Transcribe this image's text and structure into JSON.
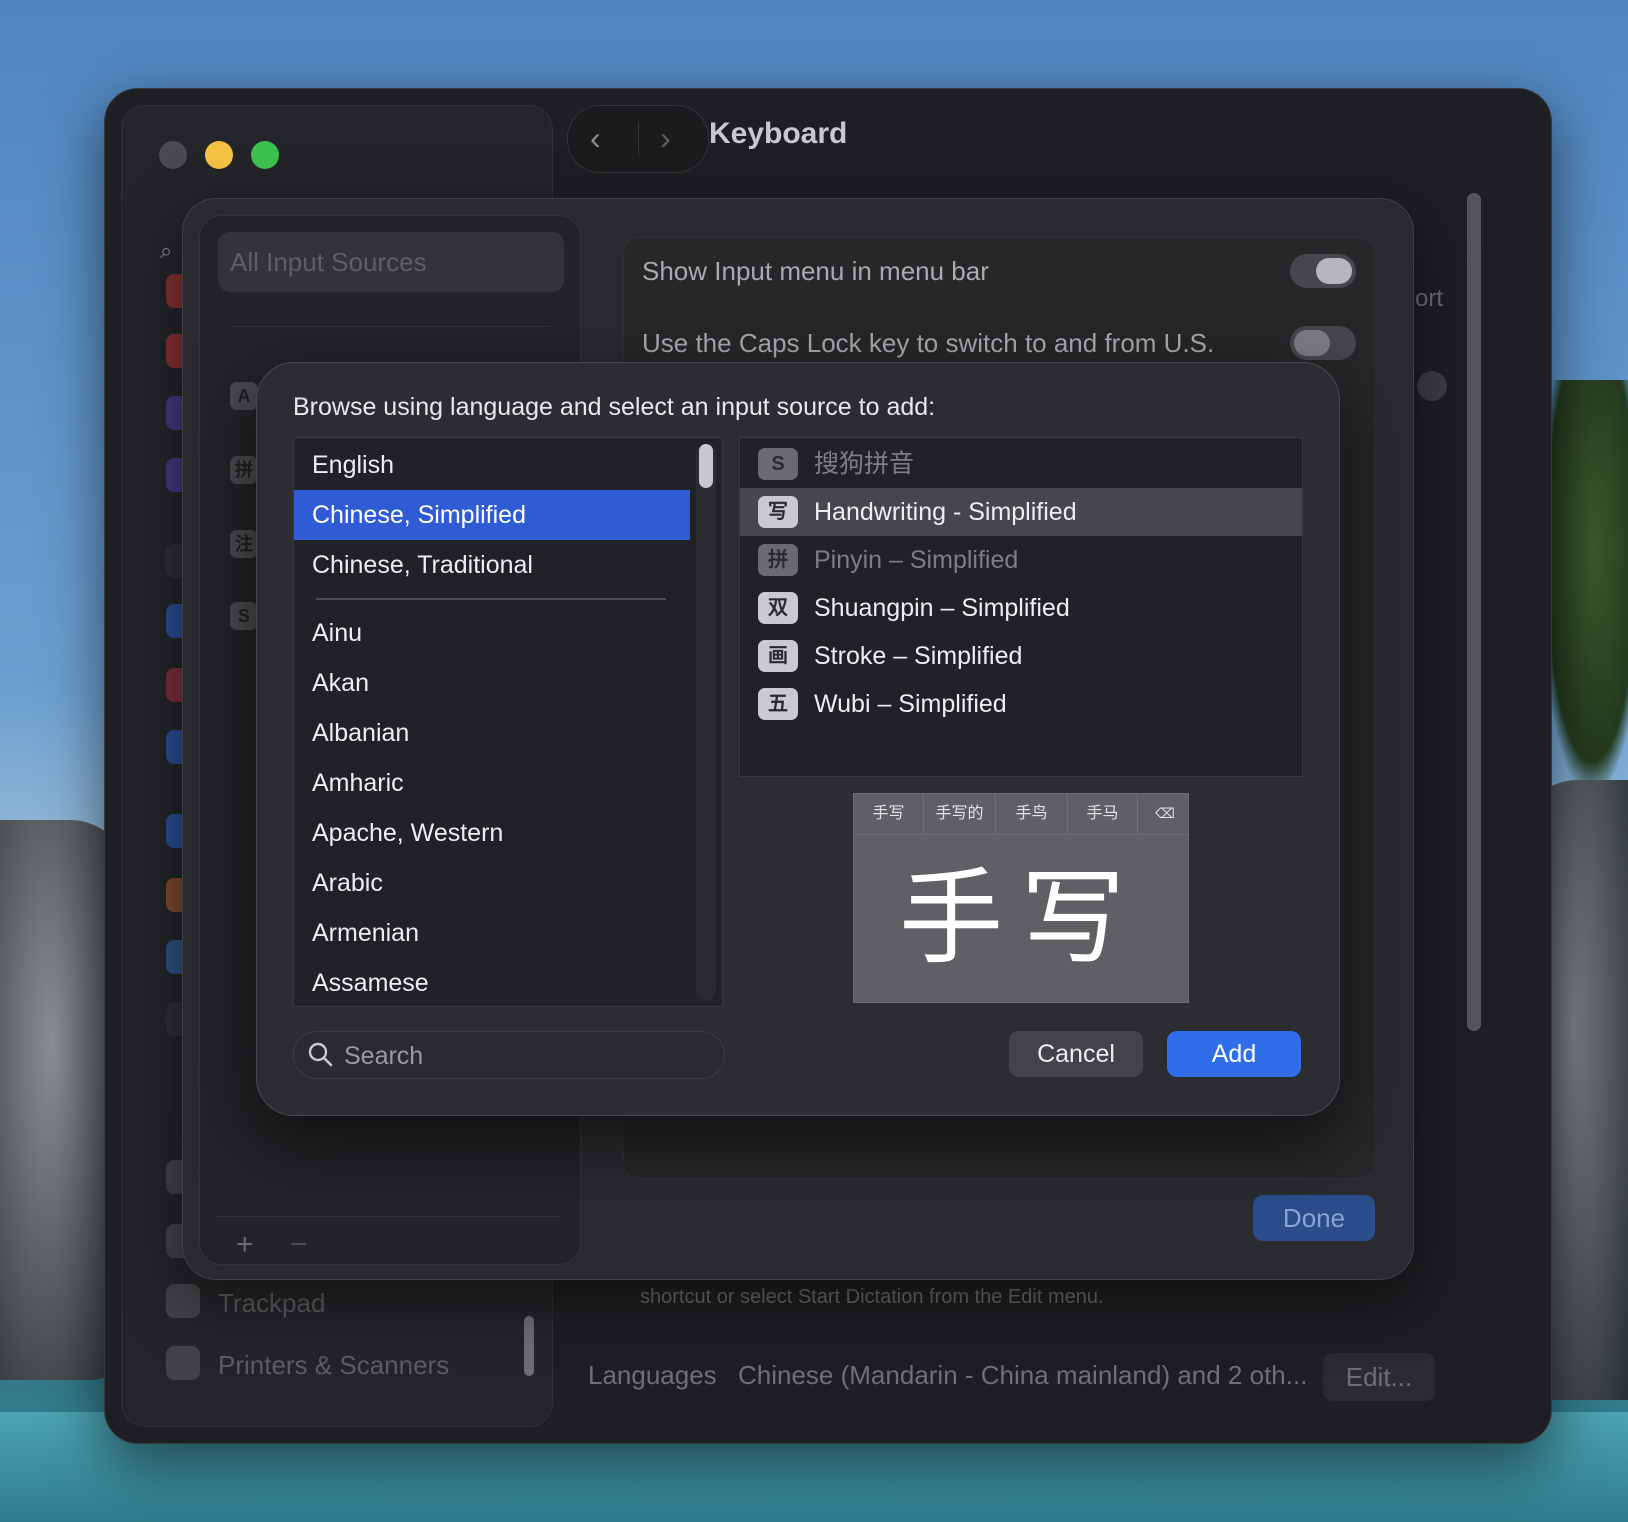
{
  "window": {
    "title": "Keyboard"
  },
  "sidebar": {
    "bottom_items": [
      {
        "label": "Trackpad"
      },
      {
        "label": "Printers & Scanners"
      }
    ]
  },
  "input_sources_sheet": {
    "search_placeholder": "All Input Sources",
    "settings": [
      {
        "label": "Show Input menu in menu bar",
        "on": true
      },
      {
        "label": "Use the Caps Lock key to switch to and from U.S.",
        "on": false
      }
    ],
    "done_label": "Done",
    "add_symbol": "+",
    "remove_symbol": "−"
  },
  "background": {
    "dictation_text": "shortcut or select Start Dictation from the Edit menu.",
    "languages_label": "Languages",
    "languages_value": "Chinese (Mandarin - China mainland) and 2 oth...",
    "edit_label": "Edit...",
    "truncated_right": "ort"
  },
  "dialog": {
    "prompt": "Browse using language and select an input source to add:",
    "languages_top": [
      {
        "label": "English",
        "selected": false
      },
      {
        "label": "Chinese, Simplified",
        "selected": true
      },
      {
        "label": "Chinese, Traditional",
        "selected": false
      }
    ],
    "languages": [
      "Ainu",
      "Akan",
      "Albanian",
      "Amharic",
      "Apache, Western",
      "Arabic",
      "Armenian",
      "Assamese"
    ],
    "sources": [
      {
        "icon_text": "S",
        "icon_name": "sogou-icon",
        "label": "搜狗拼音",
        "dim": true,
        "selected": false
      },
      {
        "icon_text": "写",
        "icon_name": "handwriting-icon",
        "label": "Handwriting - Simplified",
        "dim": false,
        "selected": true
      },
      {
        "icon_text": "拼",
        "icon_name": "pinyin-icon",
        "label": "Pinyin – Simplified",
        "dim": true,
        "selected": false
      },
      {
        "icon_text": "双",
        "icon_name": "shuangpin-icon",
        "label": "Shuangpin – Simplified",
        "dim": false,
        "selected": false
      },
      {
        "icon_text": "画",
        "icon_name": "stroke-icon",
        "label": "Stroke – Simplified",
        "dim": false,
        "selected": false
      },
      {
        "icon_text": "五",
        "icon_name": "wubi-icon",
        "label": "Wubi – Simplified",
        "dim": false,
        "selected": false
      }
    ],
    "preview": {
      "candidates": [
        "手写",
        "手写的",
        "手鸟",
        "手马"
      ],
      "delete_icon": "⌫",
      "handwritten": "手写"
    },
    "search_placeholder": "Search",
    "cancel_label": "Cancel",
    "add_label": "Add"
  },
  "colors": {
    "accent": "#2f6ee8",
    "selection": "#2f5bd4"
  }
}
